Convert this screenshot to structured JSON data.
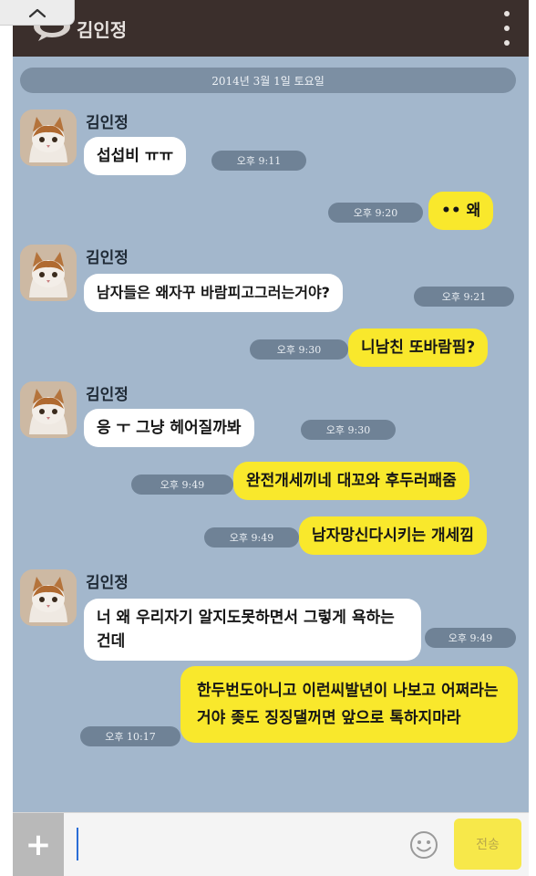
{
  "header": {
    "title": "김인정"
  },
  "date_divider": "2014년 3월 1일 토요일",
  "messages": [
    {
      "sender": "김인정",
      "text": "섭섭비 ㅠㅠ",
      "time": "오후 9:11"
    },
    {
      "text": "•• 왜",
      "time": "오후 9:20"
    },
    {
      "sender": "김인정",
      "text": "남자들은 왜자꾸 바람피고그러는거야?",
      "time": "오후 9:21"
    },
    {
      "text": "니남친 또바람핌?",
      "time": "오후 9:30"
    },
    {
      "sender": "김인정",
      "text": "응 ㅜ 그냥 헤어질까봐",
      "time": "오후 9:30"
    },
    {
      "text": "완전개세끼네 대꼬와 후두러패줌",
      "time": "오후 9:49"
    },
    {
      "text": "남자망신다시키는 개세낌",
      "time": "오후 9:49"
    },
    {
      "sender": "김인정",
      "text": "너 왜 우리자기 알지도못하면서 그렇게 욕하는건데",
      "time": "오후 9:49"
    },
    {
      "text": "한두번도아니고 이런씨발년이 나보고 어쩌라는거야 좆도 징징댈꺼면 앞으로 톡하지마라",
      "time": "오후 10:17"
    }
  ],
  "input_bar": {
    "plus_label": "+",
    "placeholder": "",
    "send_label": "전송"
  },
  "icons": {
    "collapse": "chevron-up-icon",
    "chat": "speech-bubble-icon",
    "menu": "vertical-dots-icon",
    "emoji": "smiley-icon"
  },
  "colors": {
    "header_bg": "#3b2f2c",
    "chat_bg": "#a3b7cc",
    "outgoing_bubble": "#f9e82c",
    "incoming_bubble": "#ffffff",
    "time_pill": "#6f8296"
  }
}
